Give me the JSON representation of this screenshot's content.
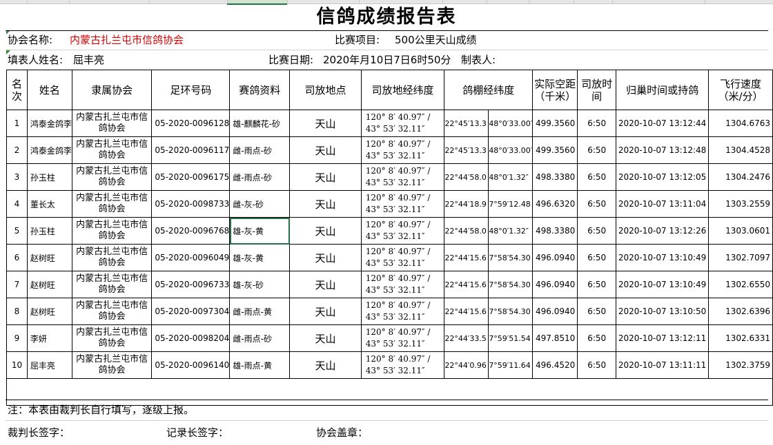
{
  "title": "信鸽成绩报告表",
  "info": {
    "association_label": "协会名称:",
    "association_value": "内蒙古扎兰屯市信鸽协会",
    "race_item_label": "比赛项目:",
    "race_item_value": "500公里天山成绩",
    "filler_label": "填表人姓名:",
    "filler_value": "屈丰亮",
    "race_date_label": "比赛日期:",
    "race_date_value": "2020年月10日7日6时50分",
    "maker_label": "制表人:"
  },
  "columns": [
    "名次",
    "姓名",
    "隶属协会",
    "足环号码",
    "赛鸽资料",
    "司放地点",
    "司放地经纬度",
    "鸽棚经纬度",
    "实际空距（千米）",
    "司放时间",
    "归巢时间或持鸽",
    "飞行速度（米/分）"
  ],
  "rows": [
    {
      "rank": "1",
      "name": "鸿泰金鸽李",
      "assoc": "内蒙古扎兰屯市信鸽协会",
      "ring": "05-2020-0096128",
      "info": "雄-麒麟花-砂",
      "place": "天山",
      "coord1": "120° 8′ 40.97″ /",
      "coord2": "43° 53′ 32.11″",
      "loft_lat": "22°45′13.3",
      "loft_lon": "48°0′33.00′",
      "dist": "499.3560",
      "release": "6:50",
      "arrive": "2020-10-07 13:12:44",
      "speed": "1304.6763"
    },
    {
      "rank": "2",
      "name": "鸿泰金鸽李",
      "assoc": "内蒙古扎兰屯市信鸽协会",
      "ring": "05-2020-0096117",
      "info": "雌-雨点-砂",
      "place": "天山",
      "coord1": "120° 8′ 40.97″ /",
      "coord2": "43° 53′ 32.11″",
      "loft_lat": "22°45′13.3",
      "loft_lon": "48°0′33.00′",
      "dist": "499.3560",
      "release": "6:50",
      "arrive": "2020-10-07 13:12:48",
      "speed": "1304.4528"
    },
    {
      "rank": "3",
      "name": "孙玉柱",
      "assoc": "内蒙古扎兰屯市信鸽协会",
      "ring": "05-2020-0096175",
      "info": "雌-雨点-砂",
      "place": "天山",
      "coord1": "120° 8′ 40.97″ /",
      "coord2": "43° 53′ 32.11″",
      "loft_lat": "22°44′58.0",
      "loft_lon": "48°0′1.32″",
      "dist": "498.3380",
      "release": "6:50",
      "arrive": "2020-10-07 13:12:05",
      "speed": "1304.2476"
    },
    {
      "rank": "4",
      "name": "董长太",
      "assoc": "内蒙古扎兰屯市信鸽协会",
      "ring": "05-2020-0098733",
      "info": "雌-灰-砂",
      "place": "天山",
      "coord1": "120° 8′ 40.97″ /",
      "coord2": "43° 53′ 32.11″",
      "loft_lat": "22°44′18.9",
      "loft_lon": "7°59′12.48",
      "dist": "496.6320",
      "release": "6:50",
      "arrive": "2020-10-07 13:11:04",
      "speed": "1303.2559"
    },
    {
      "rank": "5",
      "name": "孙玉柱",
      "assoc": "内蒙古扎兰屯市信鸽协会",
      "ring": "05-2020-0096768",
      "info": "雄-灰-黄",
      "place": "天山",
      "coord1": "120° 8′ 40.97″ /",
      "coord2": "43° 53′ 32.11″",
      "loft_lat": "22°44′58.0",
      "loft_lon": "48°0′1.32″",
      "dist": "498.3380",
      "release": "6:50",
      "arrive": "2020-10-07 13:12:26",
      "speed": "1303.0601"
    },
    {
      "rank": "6",
      "name": "赵树旺",
      "assoc": "内蒙古扎兰屯市信鸽协会",
      "ring": "05-2020-0096049",
      "info": "雄-灰-黄",
      "place": "天山",
      "coord1": "120° 8′ 40.97″ /",
      "coord2": "43° 53′ 32.11″",
      "loft_lat": "22°44′15.6",
      "loft_lon": "7°58′54.30",
      "dist": "496.0940",
      "release": "6:50",
      "arrive": "2020-10-07 13:10:49",
      "speed": "1302.7097"
    },
    {
      "rank": "7",
      "name": "赵树旺",
      "assoc": "内蒙古扎兰屯市信鸽协会",
      "ring": "05-2020-0096733",
      "info": "雄-灰-砂",
      "place": "天山",
      "coord1": "120° 8′ 40.97″ /",
      "coord2": "43° 53′ 32.11″",
      "loft_lat": "22°44′15.6",
      "loft_lon": "7°58′54.30",
      "dist": "496.0940",
      "release": "6:50",
      "arrive": "2020-10-07 13:10:49",
      "speed": "1302.6550"
    },
    {
      "rank": "8",
      "name": "赵树旺",
      "assoc": "内蒙古扎兰屯市信鸽协会",
      "ring": "05-2020-0097304",
      "info": "雌-雨点-黄",
      "place": "天山",
      "coord1": "120° 8′ 40.97″ /",
      "coord2": "43° 53′ 32.11″",
      "loft_lat": "22°44′15.6",
      "loft_lon": "7°58′54.30",
      "dist": "496.0940",
      "release": "6:50",
      "arrive": "2020-10-07 13:10:50",
      "speed": "1302.6396"
    },
    {
      "rank": "9",
      "name": "李妍",
      "assoc": "内蒙古扎兰屯市信鸽协会",
      "ring": "05-2020-0098204",
      "info": "雌-雨点-砂",
      "place": "天山",
      "coord1": "120° 8′ 40.97″ /",
      "coord2": "43° 53′ 32.11″",
      "loft_lat": "22°44′33.5",
      "loft_lon": "7°59′51.54",
      "dist": "497.8510",
      "release": "6:50",
      "arrive": "2020-10-07 13:12:11",
      "speed": "1302.6331"
    },
    {
      "rank": "10",
      "name": "屈丰亮",
      "assoc": "内蒙古扎兰屯市信鸽协会",
      "ring": "05-2020-0096140",
      "info": "雄-雨点-黄",
      "place": "天山",
      "coord1": "120° 8′ 40.97″ /",
      "coord2": "43° 53′ 32.11″",
      "loft_lat": "22°44′0.96",
      "loft_lon": "7°59′11.64",
      "dist": "496.4520",
      "release": "6:50",
      "arrive": "2020-10-07 13:11:11",
      "speed": "1302.3759"
    }
  ],
  "footer": {
    "note": "注：本表由裁判长自行填写，逐级上报。",
    "referee_sign": "裁判长签字：",
    "recorder_sign": "记录长签字：",
    "seal": "协会盖章："
  },
  "colors": {
    "association_text": "#d40000",
    "selection_border": "#217346"
  }
}
